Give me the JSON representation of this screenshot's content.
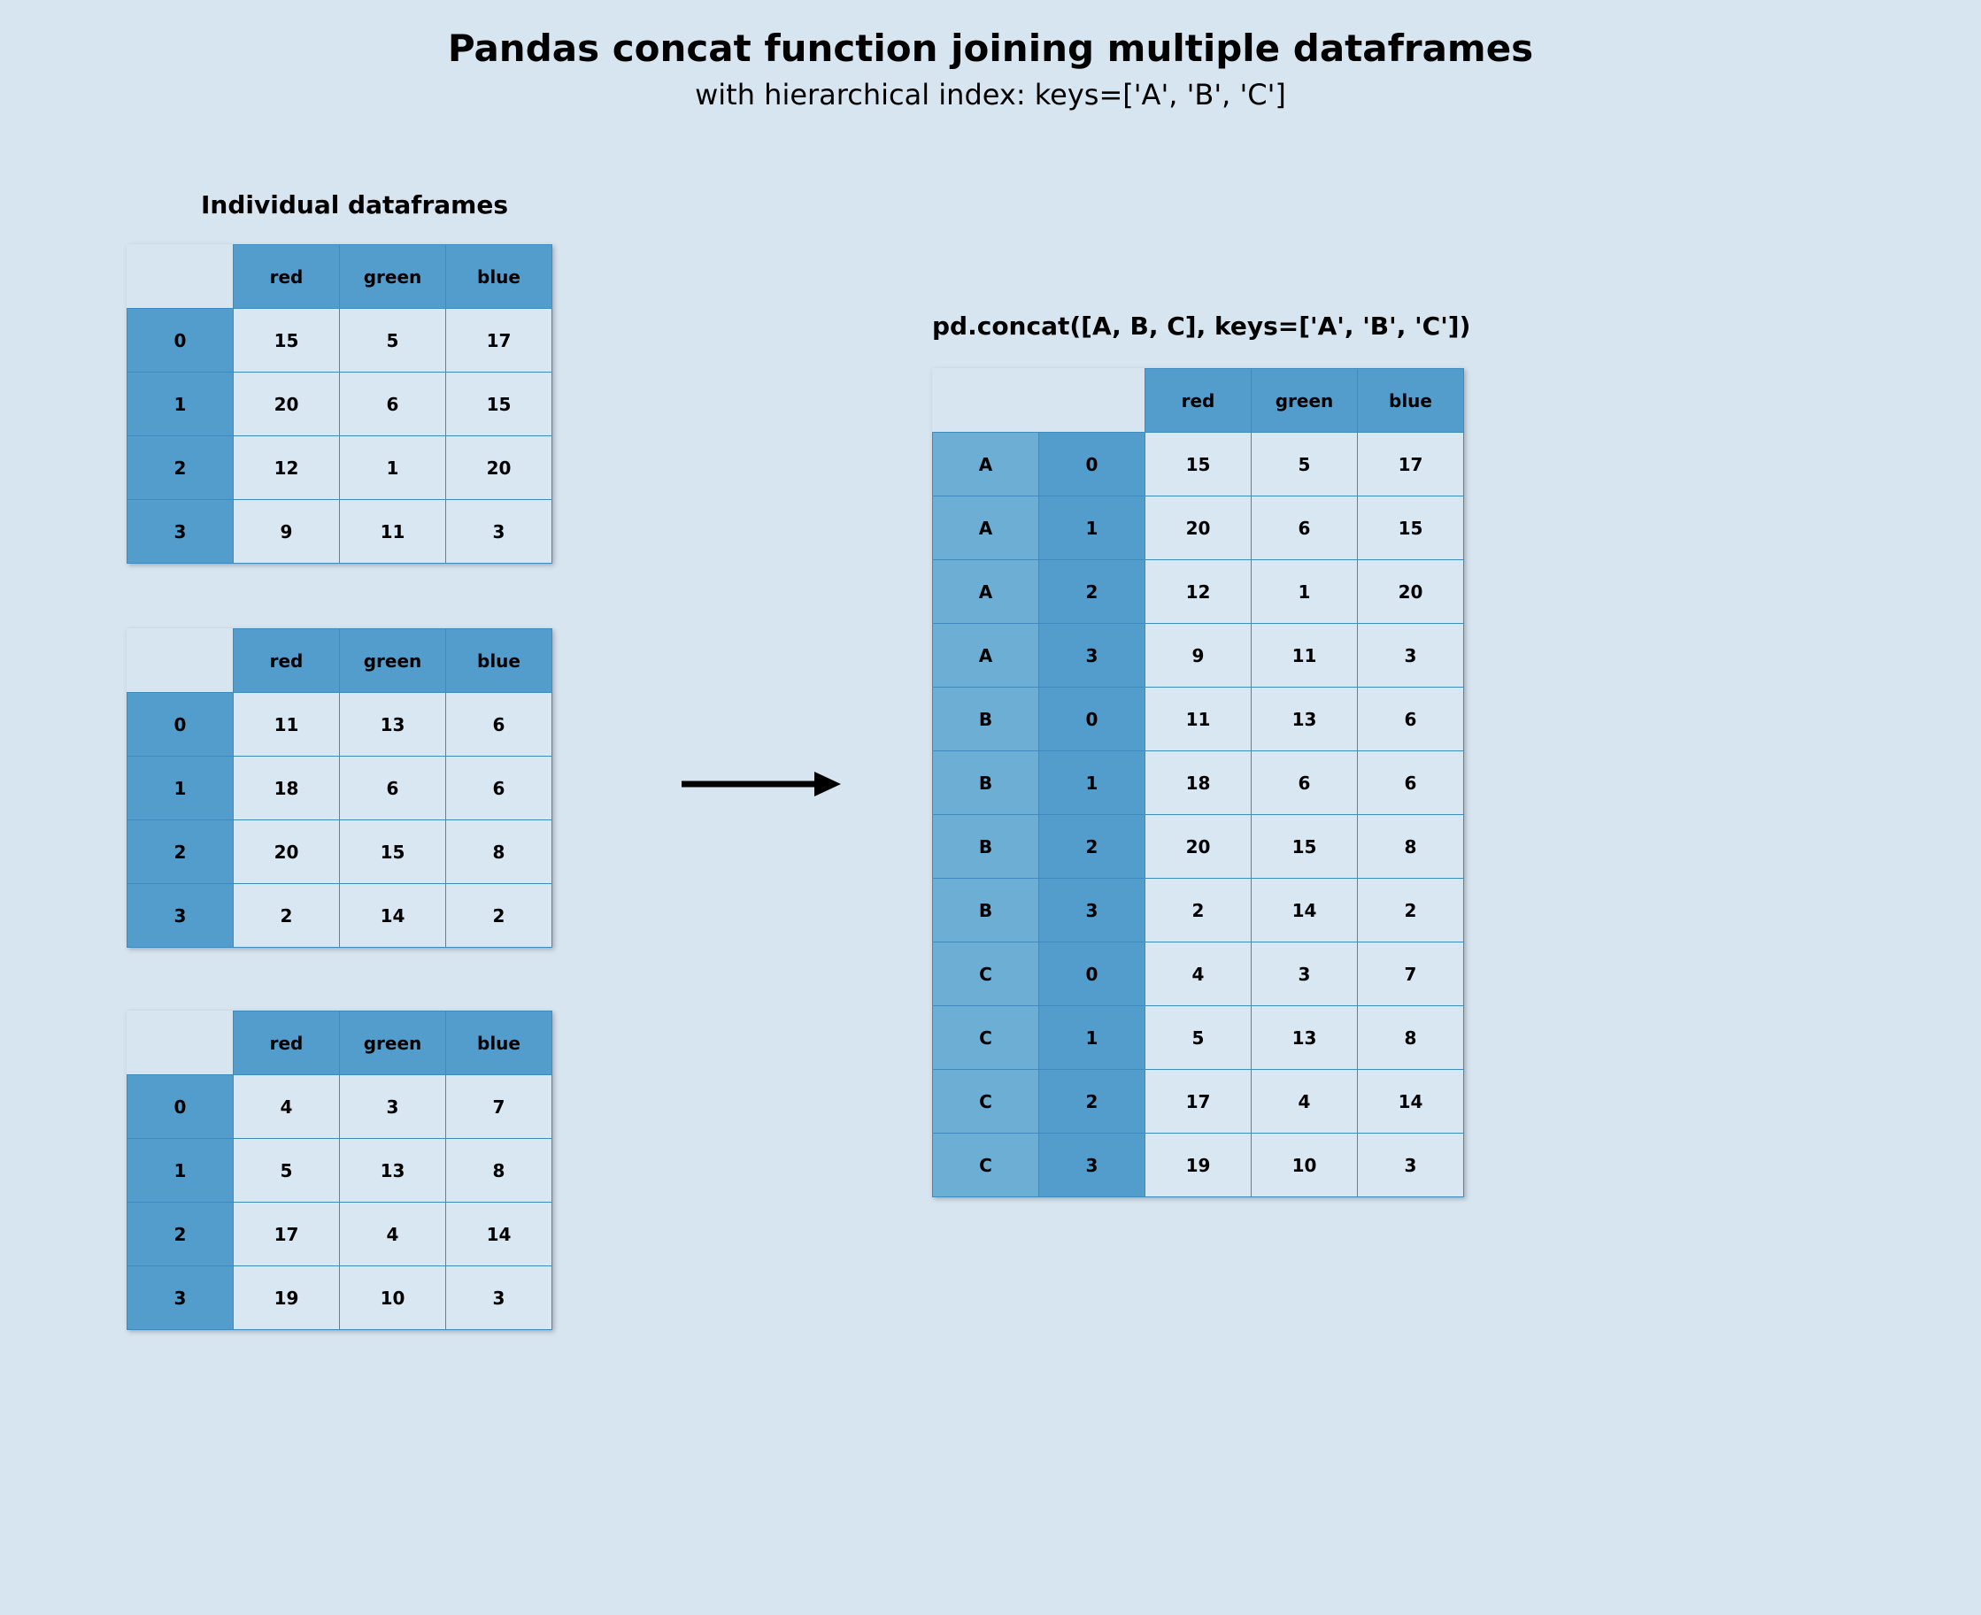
{
  "title": "Pandas concat function joining multiple dataframes",
  "subtitle": "with hierarchical index: keys=['A', 'B', 'C']",
  "left_label": "Individual dataframes",
  "right_label": "pd.concat([A, B, C], keys=['A', 'B', 'C'])",
  "columns": [
    "red",
    "green",
    "blue"
  ],
  "row_index": [
    "0",
    "1",
    "2",
    "3"
  ],
  "keys": [
    "A",
    "B",
    "C"
  ],
  "df_a": [
    [
      15,
      5,
      17
    ],
    [
      20,
      6,
      15
    ],
    [
      12,
      1,
      20
    ],
    [
      9,
      11,
      3
    ]
  ],
  "df_b": [
    [
      11,
      13,
      6
    ],
    [
      18,
      6,
      6
    ],
    [
      20,
      15,
      8
    ],
    [
      2,
      14,
      2
    ]
  ],
  "df_c": [
    [
      4,
      3,
      7
    ],
    [
      5,
      13,
      8
    ],
    [
      17,
      4,
      14
    ],
    [
      19,
      10,
      3
    ]
  ],
  "concat": [
    [
      "A",
      "0",
      15,
      5,
      17
    ],
    [
      "A",
      "1",
      20,
      6,
      15
    ],
    [
      "A",
      "2",
      12,
      1,
      20
    ],
    [
      "A",
      "3",
      9,
      11,
      3
    ],
    [
      "B",
      "0",
      11,
      13,
      6
    ],
    [
      "B",
      "1",
      18,
      6,
      6
    ],
    [
      "B",
      "2",
      20,
      15,
      8
    ],
    [
      "B",
      "3",
      2,
      14,
      2
    ],
    [
      "C",
      "0",
      4,
      3,
      7
    ],
    [
      "C",
      "1",
      5,
      13,
      8
    ],
    [
      "C",
      "2",
      17,
      4,
      14
    ],
    [
      "C",
      "3",
      19,
      10,
      3
    ]
  ]
}
